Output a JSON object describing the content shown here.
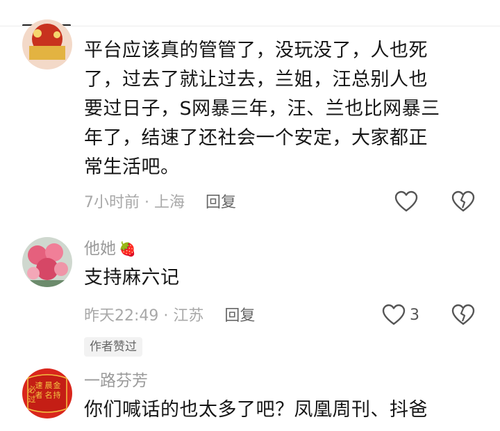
{
  "comments": [
    {
      "username": "",
      "text_lines": [
        "平台应该真的管管了，没玩没了，人也死",
        "了，过去了就让过去，兰姐，汪总别人也",
        "要过日子，S网暴三年，汪、兰也比网暴三",
        "年了，结速了还社会一个安定，大家都正",
        "常生活吧。"
      ],
      "time_location": "7小时前 · 上海",
      "reply_label": "回复",
      "like_count": ""
    },
    {
      "username": "他她",
      "badge": "🍓",
      "text_lines": [
        "支持麻六记"
      ],
      "time_location": "昨天22:49 · 江苏",
      "reply_label": "回复",
      "like_count": "3",
      "author_tag": "作者赞过"
    },
    {
      "username": "一路芬芳",
      "text_lines": [
        "你们喊话的也太多了吧？凤凰周刊、抖爸"
      ],
      "avatar_text": [
        "金",
        "持",
        "晨",
        "名",
        "速",
        "者",
        "必",
        "过"
      ]
    }
  ],
  "colors": {
    "meta_gray": "#a8a8a8",
    "text": "#161616",
    "tag_bg": "#f2f2f2",
    "avatar_red": "#d9261c",
    "avatar_gold": "#f4c542"
  },
  "icons": [
    "heart-outline-icon",
    "broken-heart-icon"
  ]
}
